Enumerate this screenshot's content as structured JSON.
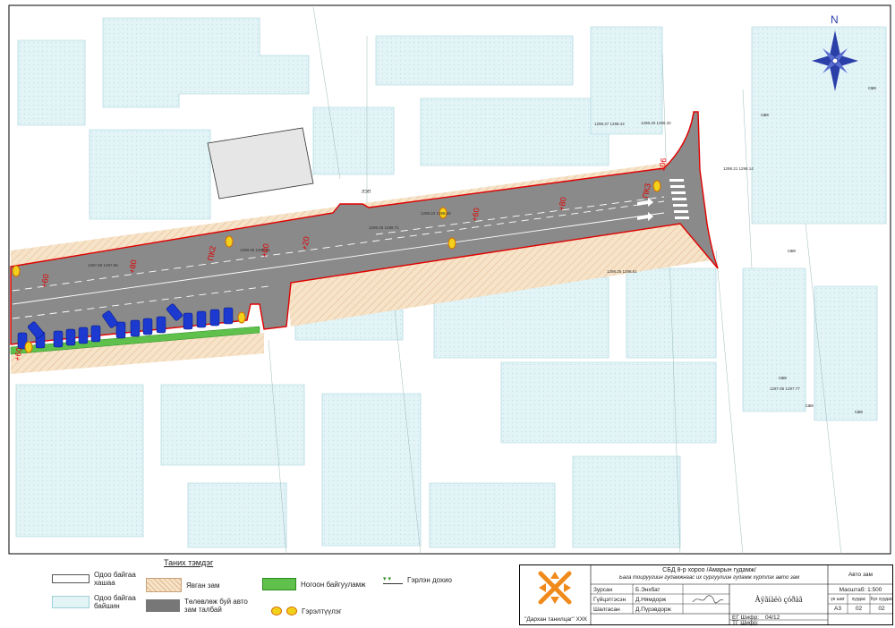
{
  "north": "N",
  "stations": [
    "ПК2",
    "ПК3",
    "106"
  ],
  "speed_marks": [
    "+60",
    "+80",
    "+80",
    "+20",
    "+60",
    "+80",
    "+60"
  ],
  "elevations": [
    "1297.69 1297.96",
    "1298.05 1298.41",
    "1298.45 1298.71",
    "1298.47 1298.44",
    "1298.40 1298.32",
    "1298.23 1298.25",
    "1298.21 1298.14",
    "1298.25 1298.51",
    "1297.85 1297.77"
  ],
  "map_labels": {
    "sam": "сам",
    "pole": "ЛЭП"
  },
  "legend": {
    "title": "Таних тэмдэг",
    "fence": "Одоо байгаа хашаа",
    "building": "Одоо байгаа байшин",
    "sidewalk": "Явган зам",
    "parking": "Төлөвлөж буй авто зам талбай",
    "green": "Ногоон байгууламж",
    "lighting": "Гэрэлтүүлэг",
    "traffic_light": "Гэрлэн дохио"
  },
  "title_block": {
    "project_line1": "СБД 8-р хороо /Амарын гудамж/",
    "project_line2": "Бага тойруугийн гудамжнаас их сургуулийн гудамж хүртлэх авто зам",
    "sheet_type": "Авто зам",
    "drawing_title": "Àÿãíàëò çóðàã",
    "roles": [
      {
        "role": "Зурсан",
        "name": "Б.Энхбат"
      },
      {
        "role": "Гүйцэтгэсэн",
        "name": "Д.Нямдорж"
      },
      {
        "role": "Шалгасан",
        "name": "Д.Пүрэвдорж"
      }
    ],
    "company": "\"Дархан танилцаг\" ХХК",
    "scale": "Масштаб: 1:500",
    "eg_label": "ЕГ Шифр:",
    "eg_value": "04/12",
    "tg_label": "ТГ Шифр:",
    "col_headers": [
      "үе шат",
      "хуудас",
      "бүх хуудас"
    ],
    "col_values": [
      "А3",
      "02",
      "02"
    ]
  }
}
